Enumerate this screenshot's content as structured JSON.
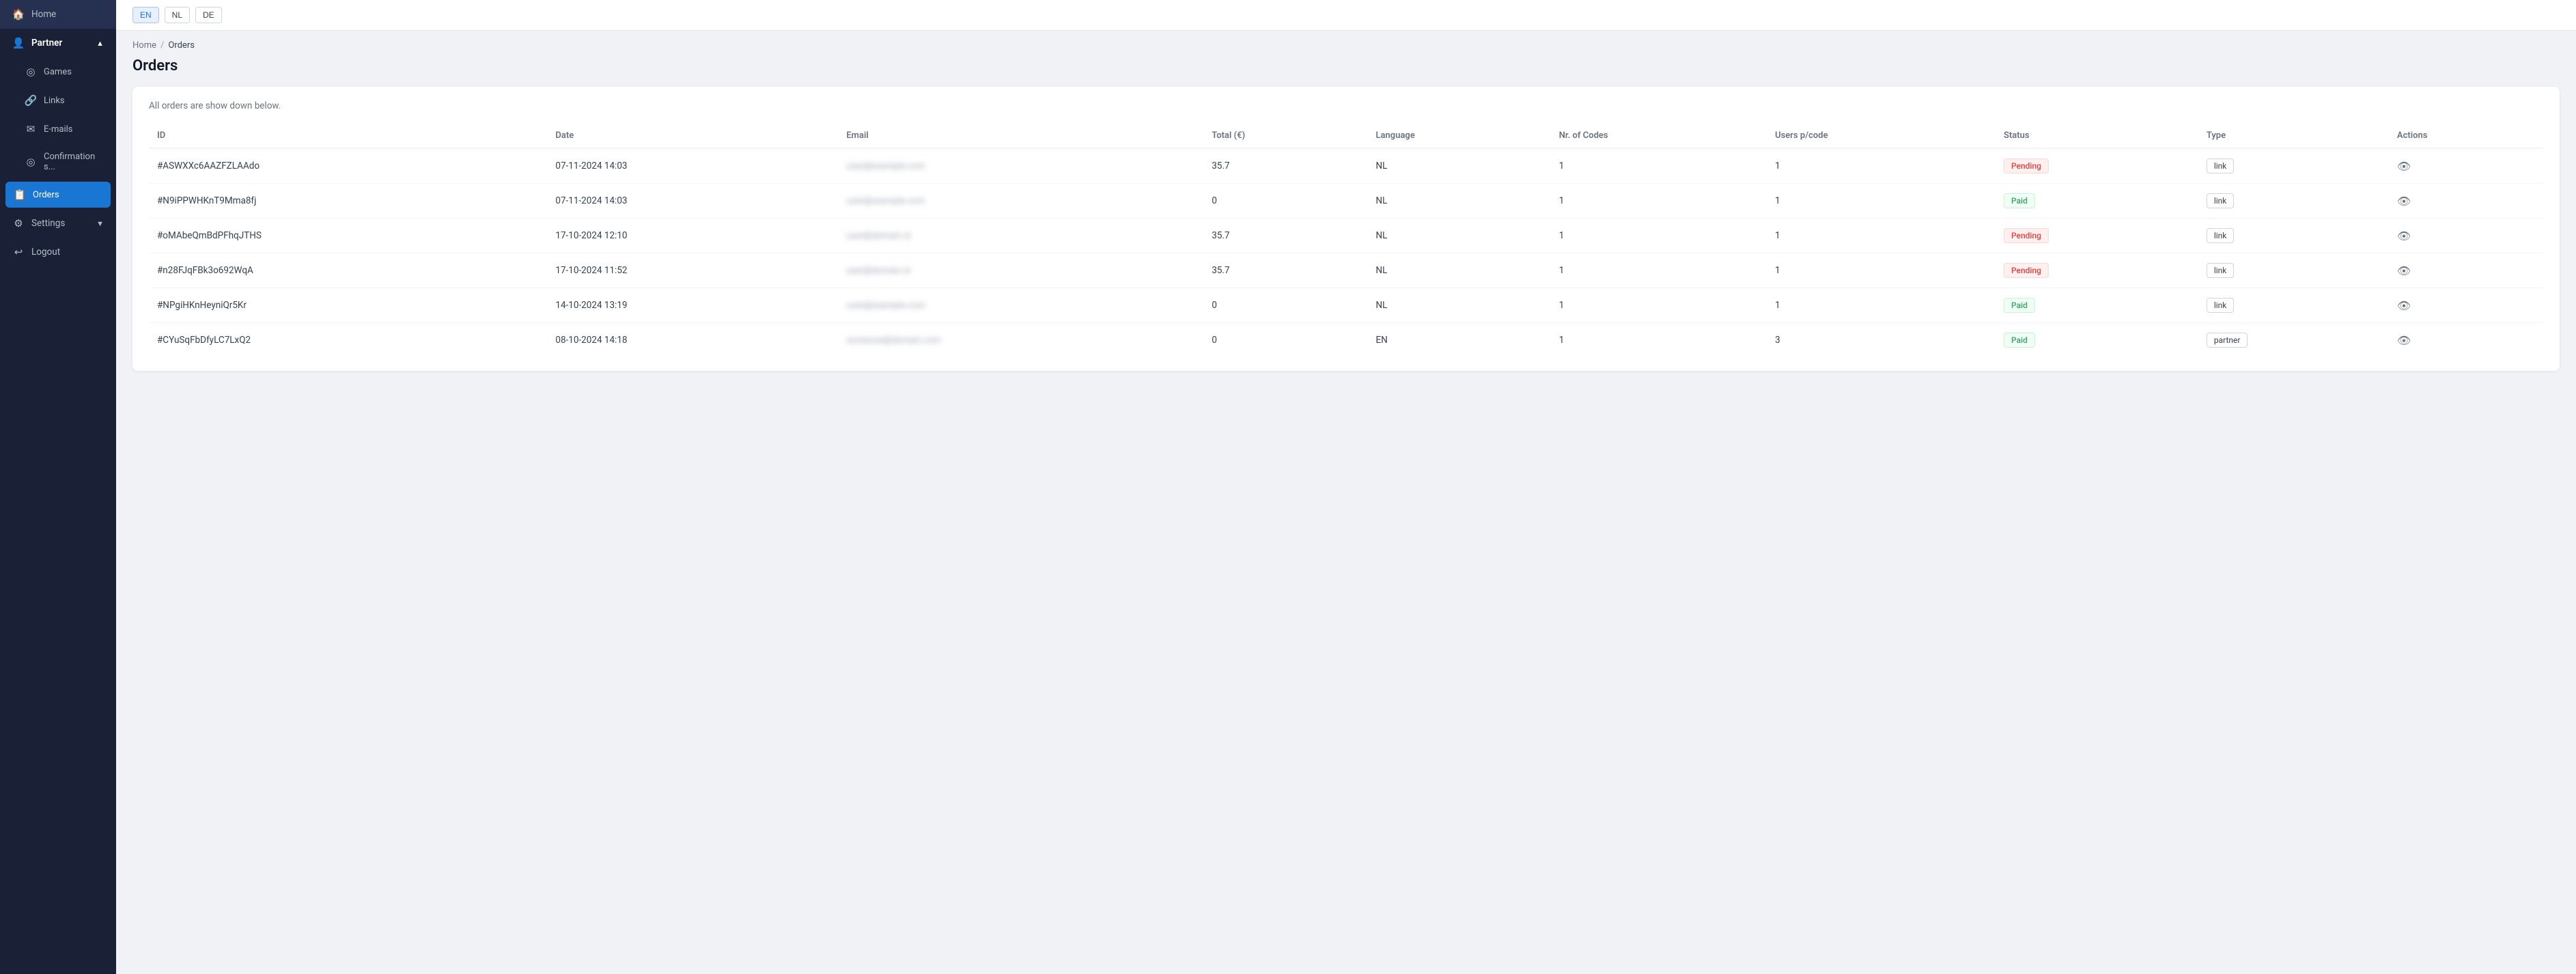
{
  "sidebar": {
    "items": [
      {
        "id": "home",
        "label": "Home",
        "icon": "🏠",
        "indent": false,
        "active": false,
        "sub": false
      },
      {
        "id": "partner",
        "label": "Partner",
        "icon": "👤",
        "indent": false,
        "active": false,
        "sub": false,
        "hasChevron": true,
        "chevron": "▲"
      },
      {
        "id": "games",
        "label": "Games",
        "icon": "◎",
        "indent": true,
        "active": false,
        "sub": true
      },
      {
        "id": "links",
        "label": "Links",
        "icon": "🔗",
        "indent": true,
        "active": false,
        "sub": true
      },
      {
        "id": "emails",
        "label": "E-mails",
        "icon": "✉",
        "indent": true,
        "active": false,
        "sub": true
      },
      {
        "id": "confirmation",
        "label": "Confirmation s...",
        "icon": "◎",
        "indent": true,
        "active": false,
        "sub": true
      },
      {
        "id": "orders",
        "label": "Orders",
        "icon": "📋",
        "indent": true,
        "active": true,
        "sub": true
      },
      {
        "id": "settings",
        "label": "Settings",
        "icon": "⚙",
        "indent": false,
        "active": false,
        "sub": false,
        "hasChevron": true,
        "chevron": "▼"
      },
      {
        "id": "logout",
        "label": "Logout",
        "icon": "↩",
        "indent": false,
        "active": false,
        "sub": false
      }
    ]
  },
  "topbar": {
    "languages": [
      {
        "code": "EN",
        "active": true
      },
      {
        "code": "NL",
        "active": false
      },
      {
        "code": "DE",
        "active": false
      }
    ]
  },
  "breadcrumb": {
    "home": "Home",
    "separator": "/",
    "current": "Orders"
  },
  "page": {
    "title": "Orders",
    "subtitle": "All orders are show down below."
  },
  "table": {
    "columns": [
      {
        "id": "id",
        "label": "ID"
      },
      {
        "id": "date",
        "label": "Date"
      },
      {
        "id": "email",
        "label": "Email"
      },
      {
        "id": "total",
        "label": "Total (€)"
      },
      {
        "id": "language",
        "label": "Language"
      },
      {
        "id": "nr_codes",
        "label": "Nr. of Codes"
      },
      {
        "id": "users_pcode",
        "label": "Users p/code"
      },
      {
        "id": "status",
        "label": "Status"
      },
      {
        "id": "type",
        "label": "Type"
      },
      {
        "id": "actions",
        "label": "Actions"
      }
    ],
    "rows": [
      {
        "id": "#ASWXXc6AAZFZLAAdo",
        "date": "07-11-2024 14:03",
        "email": "user@example.com",
        "total": "35.7",
        "language": "NL",
        "nr_codes": "1",
        "users_pcode": "1",
        "status": "Pending",
        "status_type": "pending",
        "type": "link",
        "type_style": "btn"
      },
      {
        "id": "#N9iPPWHKnT9Mma8fj",
        "date": "07-11-2024 14:03",
        "email": "user@example.com",
        "total": "0",
        "language": "NL",
        "nr_codes": "1",
        "users_pcode": "1",
        "status": "Paid",
        "status_type": "paid",
        "type": "link",
        "type_style": "btn"
      },
      {
        "id": "#oMAbeQmBdPFhqJTHS",
        "date": "17-10-2024 12:10",
        "email": "user@domain.nl",
        "total": "35.7",
        "language": "NL",
        "nr_codes": "1",
        "users_pcode": "1",
        "status": "Pending",
        "status_type": "pending",
        "type": "link",
        "type_style": "btn"
      },
      {
        "id": "#n28FJqFBk3o692WqA",
        "date": "17-10-2024 11:52",
        "email": "user@domain.nl",
        "total": "35.7",
        "language": "NL",
        "nr_codes": "1",
        "users_pcode": "1",
        "status": "Pending",
        "status_type": "pending",
        "type": "link",
        "type_style": "btn"
      },
      {
        "id": "#NPgiHKnHeyniQr5Kr",
        "date": "14-10-2024 13:19",
        "email": "user@example.com",
        "total": "0",
        "language": "NL",
        "nr_codes": "1",
        "users_pcode": "1",
        "status": "Paid",
        "status_type": "paid",
        "type": "link",
        "type_style": "btn"
      },
      {
        "id": "#CYuSqFbDfyLC7LxQ2",
        "date": "08-10-2024 14:18",
        "email": "someone@domain.com",
        "total": "0",
        "language": "EN",
        "nr_codes": "1",
        "users_pcode": "3",
        "status": "Paid",
        "status_type": "paid",
        "type": "partner",
        "type_style": "btn"
      }
    ]
  }
}
